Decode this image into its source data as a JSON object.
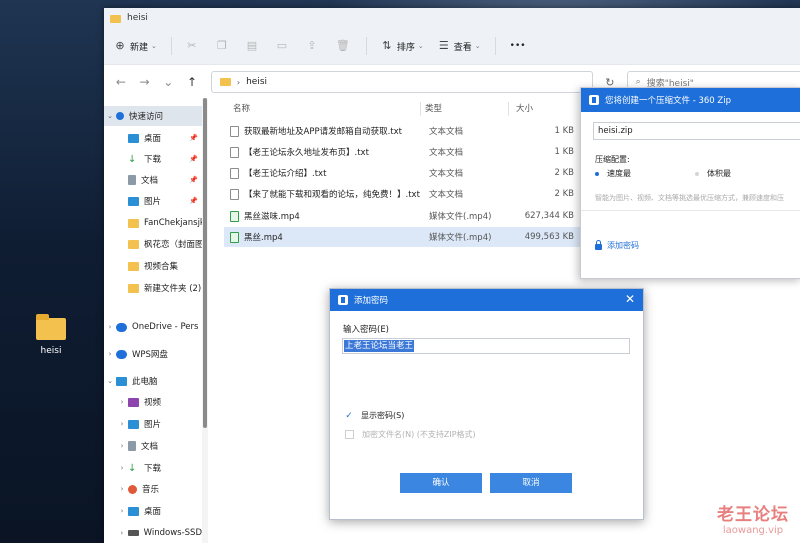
{
  "desktop": {
    "icon_label": "heisi"
  },
  "window": {
    "title": "heisi"
  },
  "toolbar": {
    "new_label": "新建",
    "sort_label": "排序",
    "view_label": "查看",
    "more_label": "•••"
  },
  "address": {
    "path": "heisi",
    "search_placeholder": "搜索\"heisi\""
  },
  "sidebar": {
    "items": [
      {
        "label": "快速访问",
        "color": "#1e6fd9"
      },
      {
        "label": "桌面",
        "color": "#2b8fd6"
      },
      {
        "label": "下载",
        "color": "#2f9e44"
      },
      {
        "label": "文档",
        "color": "#8c9aa8"
      },
      {
        "label": "图片",
        "color": "#2b8fd6"
      },
      {
        "label": "FanChekjansjk",
        "color": "#f2c14e"
      },
      {
        "label": "枫花恋（封面图",
        "color": "#f2c14e"
      },
      {
        "label": "视频合集",
        "color": "#f2c14e"
      },
      {
        "label": "新建文件夹 (2)",
        "color": "#f2c14e"
      },
      {
        "label": "OneDrive - Pers",
        "color": "#1e6fd9"
      },
      {
        "label": "WPS网盘",
        "color": "#1e6fd9"
      },
      {
        "label": "此电脑",
        "color": "#2b8fd6"
      },
      {
        "label": "视频",
        "color": "#8e44ad"
      },
      {
        "label": "图片",
        "color": "#2b8fd6"
      },
      {
        "label": "文档",
        "color": "#8c9aa8"
      },
      {
        "label": "下载",
        "color": "#2f9e44"
      },
      {
        "label": "音乐",
        "color": "#e05a3a"
      },
      {
        "label": "桌面",
        "color": "#2b8fd6"
      },
      {
        "label": "Windows-SSD",
        "color": "#555555"
      }
    ]
  },
  "files": {
    "headers": {
      "name": "名称",
      "type": "类型",
      "size": "大小"
    },
    "rows": [
      {
        "name": "获取最新地址及APP请发邮箱自动获取.txt",
        "type": "文本文档",
        "size": "1 KB"
      },
      {
        "name": "【老王论坛永久地址发布页】.txt",
        "type": "文本文档",
        "size": "1 KB"
      },
      {
        "name": "【老王论坛介绍】.txt",
        "type": "文本文档",
        "size": "2 KB"
      },
      {
        "name": "【来了就能下载和观看的论坛，纯免费！】.txt",
        "type": "文本文档",
        "size": "2 KB"
      },
      {
        "name": "黑丝滋味.mp4",
        "type": "媒体文件(.mp4)",
        "size": "627,344 KB"
      },
      {
        "name": "黑丝.mp4",
        "type": "媒体文件(.mp4)",
        "size": "499,563 KB"
      }
    ]
  },
  "zip_dialog": {
    "title": "您将创建一个压缩文件 - 360 Zip",
    "filename": "heisi.zip",
    "config_label": "压缩配置:",
    "opt_fast": "速度最",
    "opt_small": "体积最",
    "desc": "智能为图片、视频、文档等挑选最优压缩方式，兼顾速度和压",
    "add_password": "添加密码"
  },
  "password_dialog": {
    "title": "添加密码",
    "label": "输入密码(E)",
    "value": "上老王论坛当老王",
    "show_password": "显示密码(S)",
    "encrypt_names": "加密文件名(N) (不支持ZIP格式)",
    "ok": "确认",
    "cancel": "取消"
  },
  "watermark": {
    "title": "老王论坛",
    "url": "laowang.vip"
  }
}
